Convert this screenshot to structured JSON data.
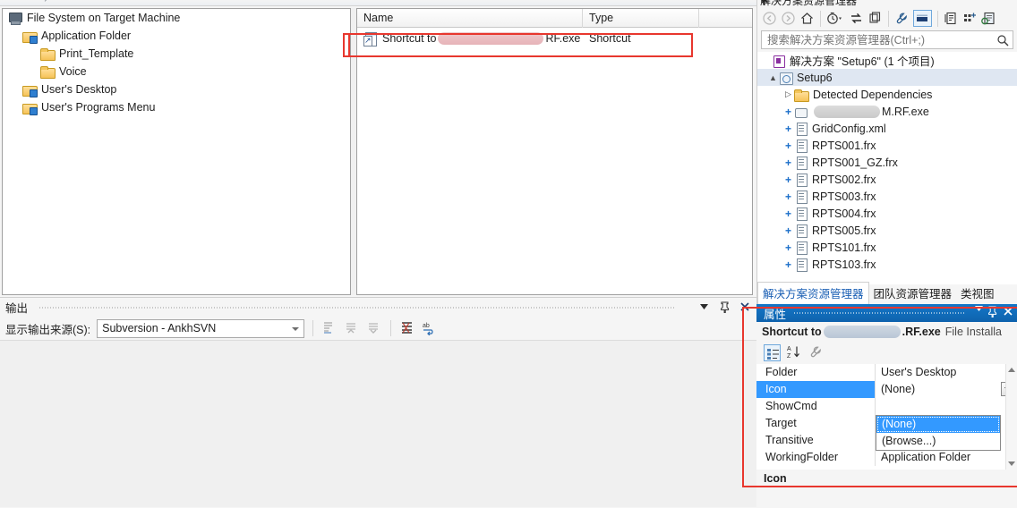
{
  "editor": {
    "tree": {
      "items": [
        {
          "label": "File System on Target Machine",
          "icon": "computer-icon",
          "indent": 0
        },
        {
          "label": "Application Folder",
          "icon": "folder-special-icon",
          "indent": 1
        },
        {
          "label": "Print_Template",
          "icon": "folder-icon",
          "indent": 2
        },
        {
          "label": "Voice",
          "icon": "folder-icon",
          "indent": 2
        },
        {
          "label": "User's Desktop",
          "icon": "folder-special-icon",
          "indent": 1
        },
        {
          "label": "User's Programs Menu",
          "icon": "folder-special-icon",
          "indent": 1
        }
      ]
    },
    "list": {
      "columns": [
        "Name",
        "Type"
      ],
      "rows": [
        {
          "name_prefix": "Shortcut to ",
          "name_redacted": true,
          "name_suffix": "RF.exe",
          "type": "Shortcut",
          "icon": "shortcut-icon",
          "annotated": true
        }
      ]
    }
  },
  "output": {
    "title": "输出",
    "source_label": "显示输出来源(S):",
    "source_value": "Subversion - AnkhSVN",
    "buttons": {
      "dropdown": "▼",
      "pin": "pin-icon",
      "close": "✕"
    },
    "toolbar_icons": [
      "find-message-icon",
      "go-to-previous-icon",
      "go-to-next-icon",
      "clear-all-icon",
      "toggle-word-wrap-icon"
    ]
  },
  "solution_explorer": {
    "title": "解决方案资源管理器",
    "search_placeholder": "搜索解决方案资源管理器(Ctrl+;)",
    "toolbar_icons": [
      "back-icon",
      "forward-icon",
      "home-icon",
      "pending-changes-icon",
      "sync-with-active-document-icon",
      "refresh-icon",
      "properties-icon",
      "show-all-files-icon",
      "collapse-all-icon",
      "view-code-icon",
      "preview-selected-items-icon"
    ],
    "tree": [
      {
        "label": "解决方案 \"Setup6\" (1 个项目)",
        "level": 0,
        "icon": "solution-icon",
        "marker": "",
        "selected": false
      },
      {
        "label": "Setup6",
        "level": 1,
        "icon": "setup-project-icon",
        "marker": "▲",
        "selected": true
      },
      {
        "label": "Detected Dependencies",
        "level": 2,
        "icon": "folder-icon",
        "marker": "▷",
        "selected": false
      },
      {
        "label": "M.RF.exe",
        "level": 2,
        "icon": "exe-icon",
        "marker": "+",
        "redacted": true,
        "selected": false
      },
      {
        "label": "GridConfig.xml",
        "level": 2,
        "icon": "document-icon",
        "marker": "+",
        "selected": false
      },
      {
        "label": "RPTS001.frx",
        "level": 2,
        "icon": "document-icon",
        "marker": "+",
        "selected": false
      },
      {
        "label": "RPTS001_GZ.frx",
        "level": 2,
        "icon": "document-icon",
        "marker": "+",
        "selected": false
      },
      {
        "label": "RPTS002.frx",
        "level": 2,
        "icon": "document-icon",
        "marker": "+",
        "selected": false
      },
      {
        "label": "RPTS003.frx",
        "level": 2,
        "icon": "document-icon",
        "marker": "+",
        "selected": false
      },
      {
        "label": "RPTS004.frx",
        "level": 2,
        "icon": "document-icon",
        "marker": "+",
        "selected": false
      },
      {
        "label": "RPTS005.frx",
        "level": 2,
        "icon": "document-icon",
        "marker": "+",
        "selected": false
      },
      {
        "label": "RPTS101.frx",
        "level": 2,
        "icon": "document-icon",
        "marker": "+",
        "selected": false
      },
      {
        "label": "RPTS103.frx",
        "level": 2,
        "icon": "document-icon",
        "marker": "+",
        "selected": false
      }
    ],
    "tabs": [
      {
        "label": "解决方案资源管理器",
        "active": true
      },
      {
        "label": "团队资源管理器",
        "active": false
      },
      {
        "label": "类视图",
        "active": false
      }
    ]
  },
  "properties": {
    "title": "属性",
    "object_prefix": "Shortcut to ",
    "object_suffix": ".RF.exe",
    "object_kind": "File Installa",
    "toolbar_icons": [
      "categorized-icon",
      "alphabetical-icon",
      "property-pages-icon"
    ],
    "rows": [
      {
        "name": "Folder",
        "value": "User's Desktop",
        "selected": false
      },
      {
        "name": "Icon",
        "value": "(None)",
        "selected": true,
        "dropdown_open": true
      },
      {
        "name": "ShowCmd",
        "value": "",
        "selected": false
      },
      {
        "name": "Target",
        "value": "",
        "selected": false
      },
      {
        "name": "Transitive",
        "value": "False",
        "selected": false
      },
      {
        "name": "WorkingFolder",
        "value": "Application Folder",
        "selected": false
      }
    ],
    "dropdown_items": [
      {
        "label": "(None)",
        "highlighted": true,
        "annotated": false
      },
      {
        "label": "(Browse...)",
        "highlighted": false,
        "annotated": true
      }
    ],
    "description_title": "Icon",
    "description_text": ""
  },
  "colors": {
    "annotation_red": "#e8372e",
    "selection_blue": "#3399ff",
    "caption_blue": "#1477c8",
    "tree_selection": "#dfe7f2"
  }
}
